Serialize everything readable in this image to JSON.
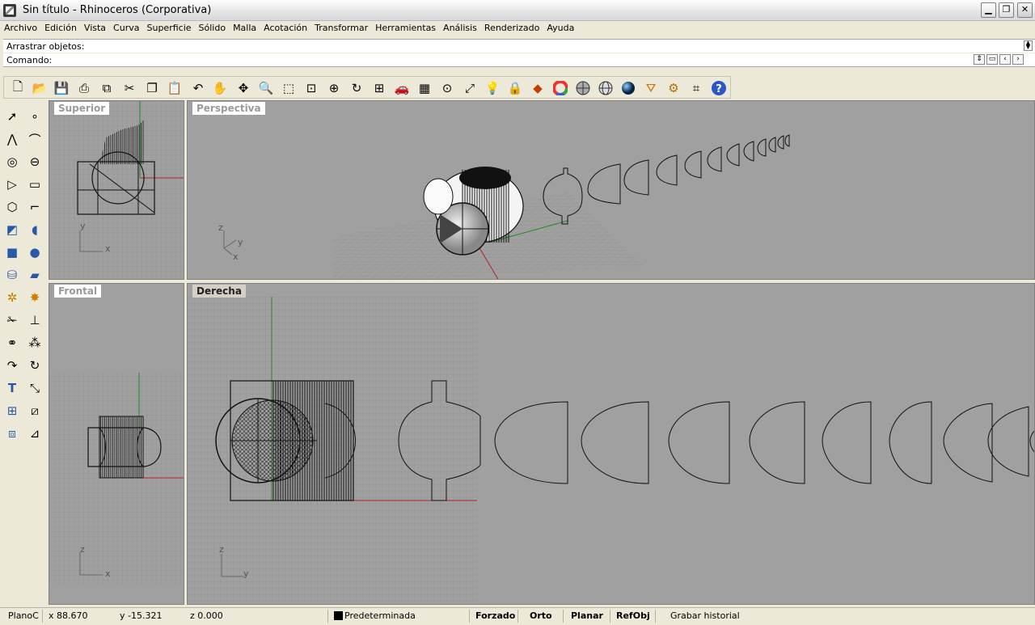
{
  "window": {
    "title": "Sin título - Rhinoceros (Corporativa)"
  },
  "menu": [
    "Archivo",
    "Edición",
    "Vista",
    "Curva",
    "Superficie",
    "Sólido",
    "Malla",
    "Acotación",
    "Transformar",
    "Herramientas",
    "Análisis",
    "Renderizado",
    "Ayuda"
  ],
  "command": {
    "history_line": "Arrastrar objetos:",
    "prompt": "Comando:"
  },
  "toolbar_icons": [
    "new-file-icon",
    "open-folder-icon",
    "save-icon",
    "print-icon",
    "import-icon",
    "cut-icon",
    "copy-icon",
    "paste-icon",
    "undo-icon",
    "pan-hand-icon",
    "rotate-view-icon",
    "zoom-icon",
    "zoom-window-icon",
    "zoom-extents-icon",
    "zoom-selected-icon",
    "redo-view-icon",
    "four-viewports-icon",
    "car-icon",
    "grid-plane-icon",
    "osnap-icon",
    "gumball-icon",
    "light-bulb-icon",
    "lock-icon",
    "layer-icon",
    "color-wheel-icon",
    "shaded-sphere-icon",
    "wire-sphere-icon",
    "render-sphere-icon",
    "blue-sphere-icon",
    "lasso-icon",
    "gear-icon",
    "options-icon",
    "help-icon"
  ],
  "left_toolbar_icons": [
    "select-arrow-icon",
    "point-icon",
    "polyline-icon",
    "curve-icon",
    "circle-icon",
    "ellipse-icon",
    "arc-icon",
    "rectangle-icon",
    "polygon-icon",
    "fillet-icon",
    "surface-icon",
    "loft-icon",
    "box-icon",
    "sphere-icon",
    "extrude-icon",
    "plane-surface-icon",
    "gear-solid-icon",
    "explode-icon",
    "trim-icon",
    "split-icon",
    "boolean-icon",
    "group-icon",
    "curve-tool-icon",
    "rotate-icon",
    "text-icon",
    "scale-icon",
    "array-icon",
    "mirror-icon",
    "cube-icon",
    "dim-icon"
  ],
  "viewports": {
    "top": {
      "label": "Superior",
      "axis_labels": [
        "y",
        "x"
      ]
    },
    "perspective": {
      "label": "Perspectiva",
      "axis_labels": [
        "z",
        "y",
        "x"
      ]
    },
    "front": {
      "label": "Frontal",
      "axis_labels": [
        "z",
        "x"
      ]
    },
    "right": {
      "label": "Derecha",
      "axis_labels": [
        "z",
        "y"
      ]
    }
  },
  "status": {
    "plane": "PlanoC",
    "x": "x 88.670",
    "y": "y -15.321",
    "z": "z 0.000",
    "layer": "Predeterminada",
    "snap": "Forzado",
    "ortho": "Orto",
    "planar": "Planar",
    "osnap": "RefObj",
    "history": "Grabar historial"
  },
  "colors": {
    "viewport_bg": "#a0a0a0",
    "grid": "#8c8c8c",
    "x_axis": "#b22222",
    "y_axis": "#1e8c1e"
  }
}
